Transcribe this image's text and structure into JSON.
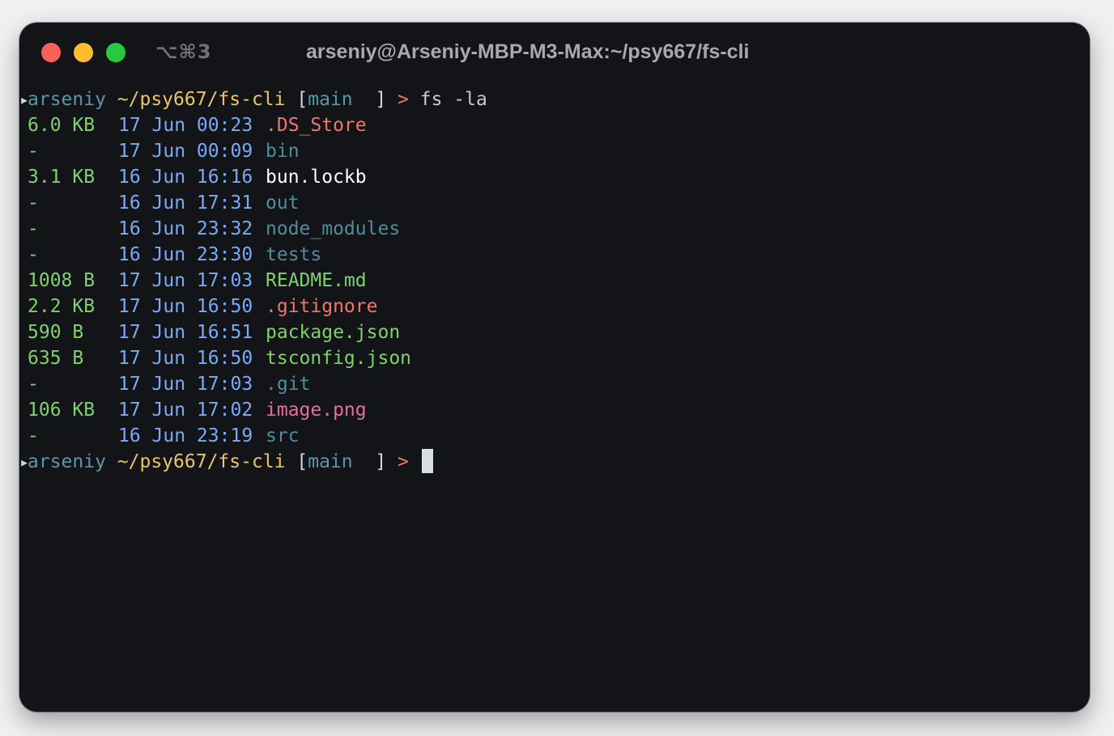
{
  "window": {
    "shortcut": "⌥⌘3",
    "title": "arseniy@Arseniy-MBP-M3-Max:~/psy667/fs-cli"
  },
  "prompt": {
    "user": "arseniy",
    "path": "~/psy667/fs-cli",
    "open_bracket": "[",
    "branch": "main",
    "close_bracket": "]",
    "symbol": ">",
    "command": "fs -la"
  },
  "listing": [
    {
      "size": "6.0 KB",
      "date": "17 Jun 00:23",
      "name": ".DS_Store"
    },
    {
      "size": "-",
      "date": "17 Jun 00:09",
      "name": "bin"
    },
    {
      "size": "3.1 KB",
      "date": "16 Jun 16:16",
      "name": "bun.lockb"
    },
    {
      "size": "-",
      "date": "16 Jun 17:31",
      "name": "out"
    },
    {
      "size": "-",
      "date": "16 Jun 23:32",
      "name": "node_modules"
    },
    {
      "size": "-",
      "date": "16 Jun 23:30",
      "name": "tests"
    },
    {
      "size": "1008 B",
      "date": "17 Jun 17:03",
      "name": "README.md"
    },
    {
      "size": "2.2 KB",
      "date": "17 Jun 16:50",
      "name": ".gitignore"
    },
    {
      "size": "590 B",
      "date": "17 Jun 16:51",
      "name": "package.json"
    },
    {
      "size": "635 B",
      "date": "17 Jun 16:50",
      "name": "tsconfig.json"
    },
    {
      "size": "-",
      "date": "17 Jun 17:03",
      "name": ".git"
    },
    {
      "size": "106 KB",
      "date": "17 Jun 17:02",
      "name": "image.png"
    },
    {
      "size": "-",
      "date": "16 Jun 23:19",
      "name": "src"
    }
  ],
  "colors": {
    "background": "#131418",
    "size": "#7ed26b",
    "date": "#7aaaf4",
    "directory": "#508c9b",
    "hidden_file": "#f07669",
    "image_file": "#e46ea4",
    "path": "#e9c46a"
  }
}
